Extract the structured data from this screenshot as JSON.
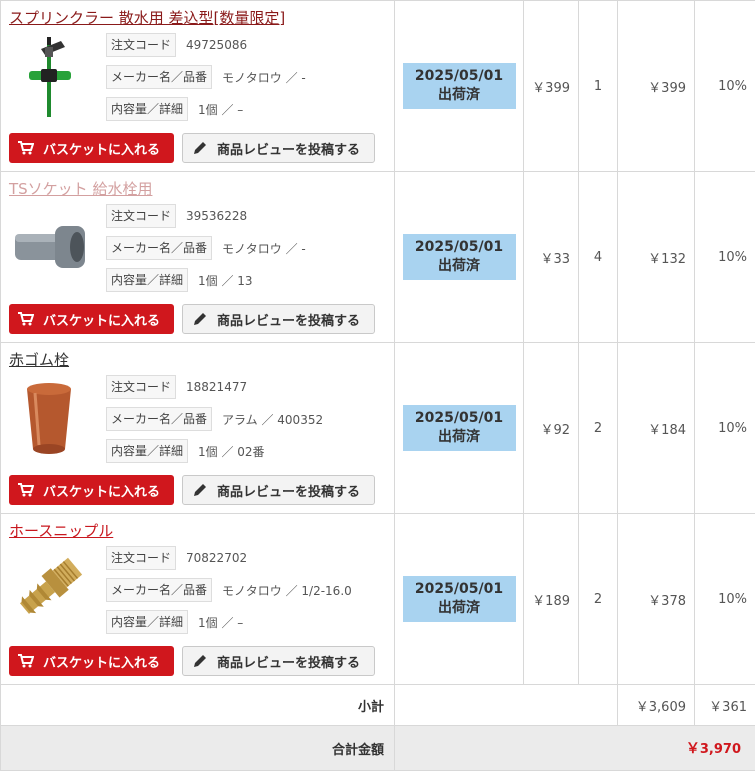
{
  "items": [
    {
      "title": "スプリンクラー 散水用 差込型[数量限定]",
      "order_code_label": "注文コード",
      "order_code": "49725086",
      "maker_label": "メーカー名／品番",
      "maker": "モノタロウ ／ -",
      "content_label": "内容量／詳細",
      "content": "1個 ／ –",
      "status_date": "2025/05/01",
      "status_text": "出荷済",
      "unit_price": "￥399",
      "qty": "1",
      "subtotal": "￥399",
      "tax": "10%",
      "basket_label": "バスケットに入れる",
      "review_label": "商品レビューを投稿する",
      "image": "sprinkler"
    },
    {
      "title": "TSソケット 給水栓用",
      "order_code_label": "注文コード",
      "order_code": "39536228",
      "maker_label": "メーカー名／品番",
      "maker": "モノタロウ ／ -",
      "content_label": "内容量／詳細",
      "content": "1個 ／ 13",
      "status_date": "2025/05/01",
      "status_text": "出荷済",
      "unit_price": "￥33",
      "qty": "4",
      "subtotal": "￥132",
      "tax": "10%",
      "basket_label": "バスケットに入れる",
      "review_label": "商品レビューを投稿する",
      "image": "pipe-socket"
    },
    {
      "title": "赤ゴム栓",
      "order_code_label": "注文コード",
      "order_code": "18821477",
      "maker_label": "メーカー名／品番",
      "maker": "アラム ／ 400352",
      "content_label": "内容量／詳細",
      "content": "1個 ／ 02番",
      "status_date": "2025/05/01",
      "status_text": "出荷済",
      "unit_price": "￥92",
      "qty": "2",
      "subtotal": "￥184",
      "tax": "10%",
      "basket_label": "バスケットに入れる",
      "review_label": "商品レビューを投稿する",
      "image": "rubber-stopper"
    },
    {
      "title": "ホースニップル",
      "order_code_label": "注文コード",
      "order_code": "70822702",
      "maker_label": "メーカー名／品番",
      "maker": "モノタロウ ／ 1/2-16.0",
      "content_label": "内容量／詳細",
      "content": "1個 ／ –",
      "status_date": "2025/05/01",
      "status_text": "出荷済",
      "unit_price": "￥189",
      "qty": "2",
      "subtotal": "￥378",
      "tax": "10%",
      "basket_label": "バスケットに入れる",
      "review_label": "商品レビューを投稿する",
      "image": "hose-nipple"
    }
  ],
  "summary": {
    "subtotal_label": "小計",
    "subtotal_value": "￥3,609",
    "tax_value": "￥361",
    "total_label": "合計金額",
    "total_currency": "￥",
    "total_amount": "3,970"
  },
  "colors": {
    "accent": "#d0171d",
    "status_bg": "#a9d3f0"
  }
}
